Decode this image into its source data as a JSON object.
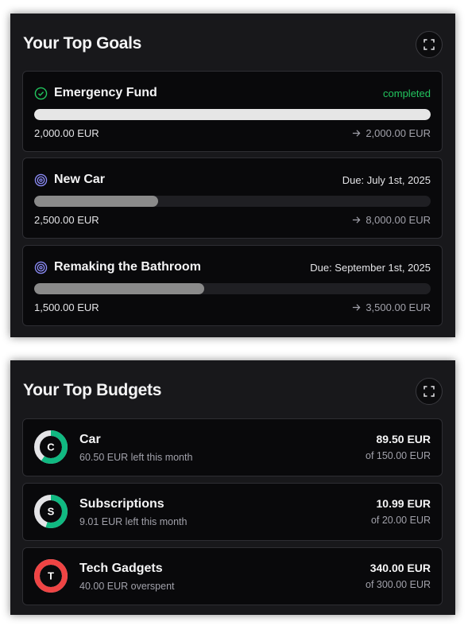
{
  "goals_panel": {
    "title": "Your Top Goals",
    "expand_icon": "expand-icon",
    "goals": [
      {
        "name": "Emergency Fund",
        "status": "completed",
        "icon": "check-circle-icon",
        "current": "2,000.00 EUR",
        "target": "2,000.00 EUR",
        "progress": 1.0,
        "status_color": "#22c55e"
      },
      {
        "name": "New Car",
        "status": "Due: July 1st, 2025",
        "icon": "target-icon",
        "current": "2,500.00 EUR",
        "target": "8,000.00 EUR",
        "progress": 0.3125
      },
      {
        "name": "Remaking the Bathroom",
        "status": "Due: September 1st, 2025",
        "icon": "target-icon",
        "current": "1,500.00 EUR",
        "target": "3,500.00 EUR",
        "progress": 0.4286
      }
    ]
  },
  "budgets_panel": {
    "title": "Your Top Budgets",
    "expand_icon": "expand-icon",
    "budgets": [
      {
        "letter": "C",
        "name": "Car",
        "note": "60.50 EUR left this month",
        "spent": "89.50 EUR",
        "of": "of 150.00 EUR",
        "ratio": 0.5967,
        "color": "#10b981"
      },
      {
        "letter": "S",
        "name": "Subscriptions",
        "note": "9.01 EUR left this month",
        "spent": "10.99 EUR",
        "of": "of 20.00 EUR",
        "ratio": 0.5495,
        "color": "#10b981"
      },
      {
        "letter": "T",
        "name": "Tech Gadgets",
        "note": "40.00 EUR overspent",
        "spent": "340.00 EUR",
        "of": "of 300.00 EUR",
        "ratio": 1.0,
        "color": "#ef4444"
      }
    ]
  },
  "colors": {
    "accent_green": "#22c55e",
    "target_purple": "#8b8bf5",
    "over_red": "#ef4444"
  }
}
